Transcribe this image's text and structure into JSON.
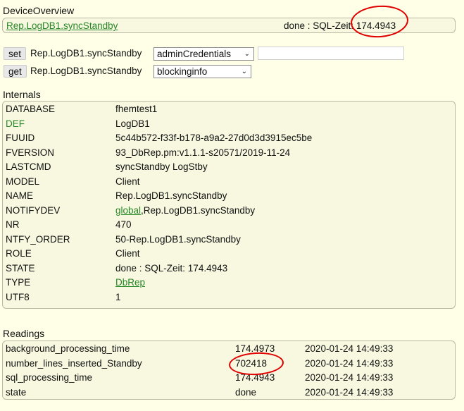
{
  "overview": {
    "title": "DeviceOverview",
    "device_link": "Rep.LogDB1.syncStandby",
    "state_prefix": "done : SQL-Zeit: ",
    "state_value": "174.4943"
  },
  "commands": {
    "set_label": "set",
    "get_label": "get",
    "device": "Rep.LogDB1.syncStandby",
    "set_select": "adminCredentials",
    "set_input": "",
    "get_select": "blockinginfo"
  },
  "internals": {
    "title": "Internals",
    "rows": [
      {
        "name": "DATABASE",
        "value": "fhemtest1"
      },
      {
        "name": "DEF",
        "value": "LogDB1"
      },
      {
        "name": "FUUID",
        "value": "5c44b572-f33f-b178-a9a2-27d0d3d3915ec5be"
      },
      {
        "name": "FVERSION",
        "value": "93_DbRep.pm:v1.1.1-s20571/2019-11-24"
      },
      {
        "name": "LASTCMD",
        "value": "syncStandby LogStby"
      },
      {
        "name": "MODEL",
        "value": "Client"
      },
      {
        "name": "NAME",
        "value": "Rep.LogDB1.syncStandby"
      },
      {
        "name": "NOTIFYDEV",
        "value_link": "global",
        "value_rest": ",Rep.LogDB1.syncStandby"
      },
      {
        "name": "NR",
        "value": "470"
      },
      {
        "name": "NTFY_ORDER",
        "value": "50-Rep.LogDB1.syncStandby"
      },
      {
        "name": "ROLE",
        "value": "Client"
      },
      {
        "name": "STATE",
        "value": "done : SQL-Zeit: 174.4943"
      },
      {
        "name": "TYPE",
        "value_link": "DbRep"
      },
      {
        "name": "UTF8",
        "value": "1"
      }
    ]
  },
  "readings": {
    "title": "Readings",
    "rows": [
      {
        "name": "background_processing_time",
        "value": "174.4973",
        "time": "2020-01-24 14:49:33"
      },
      {
        "name": "number_lines_inserted_Standby",
        "value": "702418",
        "time": "2020-01-24 14:49:33"
      },
      {
        "name": "sql_processing_time",
        "value": "174.4943",
        "time": "2020-01-24 14:49:33"
      },
      {
        "name": "state",
        "value": "done",
        "time": "2020-01-24 14:49:33"
      }
    ]
  },
  "colors": {
    "background": "#FFFFE7",
    "box": "#F8F8E0",
    "link": "#278727",
    "highlight_circle": "#E00000"
  }
}
